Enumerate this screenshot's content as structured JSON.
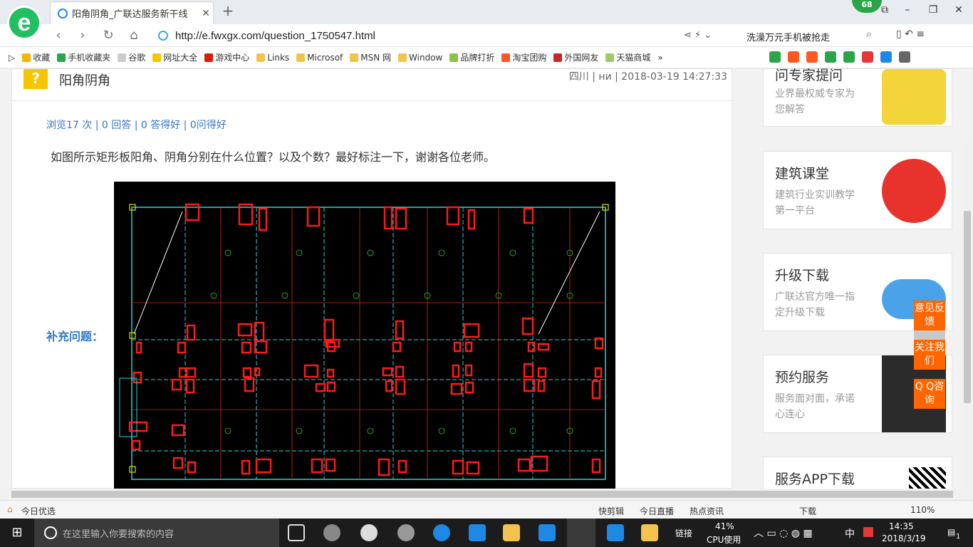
{
  "window": {
    "tab_title": "阳角阴角_广联达服务新干线",
    "badge_count": "68"
  },
  "addressbar": {
    "url": "http://e.fwxgx.com/question_1750547.html",
    "hot_search": "洗澡万元手机被抢走"
  },
  "bookmarks": [
    "收藏",
    "手机收藏夹",
    "谷歌",
    "网址大全",
    "游戏中心",
    "Links",
    "Microsof",
    "MSN 网",
    "Window",
    "品牌打折",
    "淘宝团购",
    "外国网友",
    "天猫商城"
  ],
  "question": {
    "title": "阳角阴角",
    "meta": "四川 | ни | 2018-03-19 14:27:33",
    "stats": "浏览17 次 | 0 回答 | 0 答得好 | 0问得好",
    "text": "如图所示矩形板阳角、阴角分别在什么位置？以及个数？最好标注一下，谢谢各位老师。",
    "supplement_label": "补充问题："
  },
  "sidebar": {
    "cards": [
      {
        "title": "问专家提问",
        "desc": "业界最权威专家为您解答"
      },
      {
        "title": "建筑课堂",
        "desc": "建筑行业实训教学第一平台"
      },
      {
        "title": "升级下载",
        "desc": "广联达官方唯一指定升级下载"
      },
      {
        "title": "预约服务",
        "desc": "服务面对面，承诺心连心"
      },
      {
        "title": "服务APP下载",
        "desc": ""
      }
    ],
    "float_buttons": [
      "意见反馈",
      "关注我们",
      "Q Q咨询"
    ]
  },
  "statusbar": {
    "left": "今日优选",
    "items": [
      "快剪辑",
      "今日直播",
      "热点资讯",
      "下载"
    ],
    "zoom": "110%"
  },
  "taskbar": {
    "search_placeholder": "在这里输入你要搜索的内容",
    "links_label": "链接",
    "cpu_percent": "41%",
    "cpu_label": "CPU使用",
    "ime": "中",
    "time": "14:35",
    "date": "2018/3/19",
    "notifications": "1"
  },
  "colors": {
    "accent_orange": "#ff6600",
    "link_blue": "#3675bd",
    "cad_red": "#ff0000",
    "cad_bg": "#000000"
  }
}
